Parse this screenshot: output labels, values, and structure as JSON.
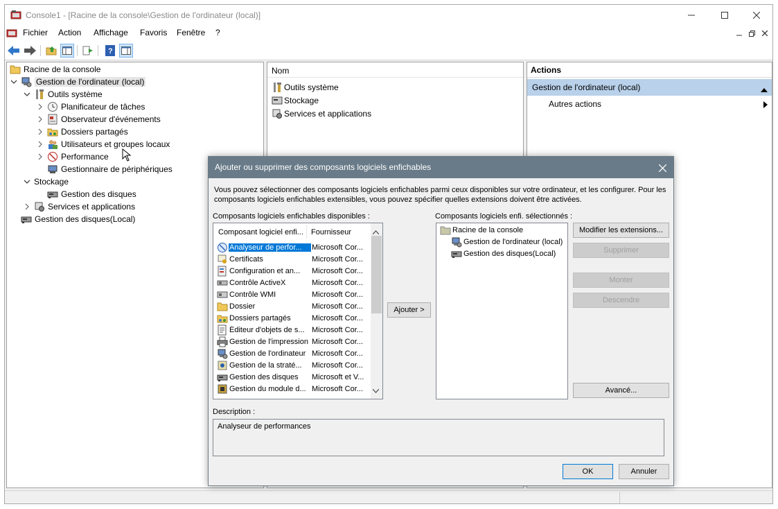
{
  "window": {
    "title": "Console1 - [Racine de la console\\Gestion de l'ordinateur (local)]",
    "buttons": {
      "minimize": "minimize",
      "maximize": "maximize",
      "close": "close"
    }
  },
  "menu": [
    "Fichier",
    "Action",
    "Affichage",
    "Favoris",
    "Fenêtre",
    "?"
  ],
  "tree": {
    "root": "Racine de la console",
    "computer": "Gestion de l'ordinateur (local)",
    "system_tools": "Outils système",
    "task_scheduler": "Planificateur de tâches",
    "event_viewer": "Observateur d'événements",
    "shared_folders": "Dossiers partagés",
    "local_users": "Utilisateurs et groupes locaux",
    "performance": "Performance",
    "device_manager": "Gestionnaire de périphériques",
    "storage": "Stockage",
    "disk_management": "Gestion des disques",
    "services_apps": "Services et applications",
    "disk_management_local": "Gestion des disques(Local)"
  },
  "result": {
    "column": "Nom",
    "items": [
      "Outils système",
      "Stockage",
      "Services et applications"
    ]
  },
  "actions": {
    "header": "Actions",
    "section": "Gestion de l'ordinateur (local)",
    "more": "Autres actions"
  },
  "dialog": {
    "title": "Ajouter ou supprimer des composants logiciels enfichables",
    "intro": "Vous pouvez sélectionner des composants logiciels enfichables parmi ceux disponibles sur votre ordinateur, et les configurer. Pour les composants logiciels enfichables extensibles, vous pouvez spécifier quelles extensions doivent être activées.",
    "available_label": "Composants logiciels enfichables disponibles :",
    "selected_label": "Composants logiciels enfi. sélectionnés :",
    "col_snapin": "Composant logiciel enfi...",
    "col_vendor": "Fournisseur",
    "available": [
      {
        "name": "Analyseur de perfor...",
        "vendor": "Microsoft Cor...",
        "icon": "performance-icon",
        "selected": true
      },
      {
        "name": "Certificats",
        "vendor": "Microsoft Cor...",
        "icon": "certificate-icon"
      },
      {
        "name": "Configuration et an...",
        "vendor": "Microsoft Cor...",
        "icon": "config-icon"
      },
      {
        "name": "Contrôle ActiveX",
        "vendor": "Microsoft Cor...",
        "icon": "activex-icon"
      },
      {
        "name": "Contrôle WMI",
        "vendor": "Microsoft Cor...",
        "icon": "wmi-icon"
      },
      {
        "name": "Dossier",
        "vendor": "Microsoft Cor...",
        "icon": "folder-icon"
      },
      {
        "name": "Dossiers partagés",
        "vendor": "Microsoft Cor...",
        "icon": "shared-folder-icon"
      },
      {
        "name": "Éditeur d'objets de s...",
        "vendor": "Microsoft Cor...",
        "icon": "policy-editor-icon"
      },
      {
        "name": "Gestion de l'impression",
        "vendor": "Microsoft Cor...",
        "icon": "printer-icon"
      },
      {
        "name": "Gestion de l'ordinateur",
        "vendor": "Microsoft Cor...",
        "icon": "computer-icon"
      },
      {
        "name": "Gestion de la straté...",
        "vendor": "Microsoft Cor...",
        "icon": "policy-icon"
      },
      {
        "name": "Gestion des disques",
        "vendor": "Microsoft et V...",
        "icon": "disk-icon"
      },
      {
        "name": "Gestion du module d...",
        "vendor": "Microsoft Cor...",
        "icon": "tpm-icon"
      }
    ],
    "selected": [
      {
        "name": "Racine de la console",
        "icon": "folder-icon",
        "level": 0
      },
      {
        "name": "Gestion de l'ordinateur (local)",
        "icon": "computer-icon",
        "level": 1
      },
      {
        "name": "Gestion des disques(Local)",
        "icon": "disk-icon",
        "level": 1
      }
    ],
    "add_button": "Ajouter >",
    "edit_extensions": "Modifier les extensions...",
    "remove": "Supprimer",
    "move_up": "Monter",
    "move_down": "Descendre",
    "advanced": "Avancé...",
    "description_label": "Description :",
    "description": "Analyseur de performances",
    "ok": "OK",
    "cancel": "Annuler"
  },
  "colors": {
    "selection": "#0078d7",
    "action_section": "#b9d1ea",
    "dialog_title": "#697b88"
  }
}
